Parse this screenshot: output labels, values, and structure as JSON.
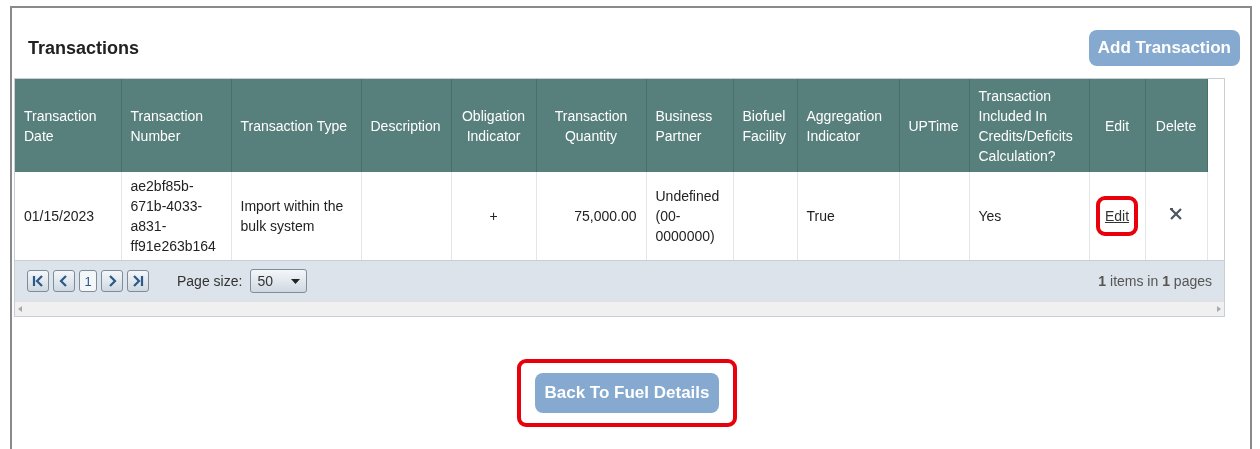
{
  "title": "Transactions",
  "add_button": {
    "label": "Add Transaction"
  },
  "table": {
    "columns": [
      "Transaction Date",
      "Transaction Number",
      "Transaction Type",
      "Description",
      "Obligation Indicator",
      "Transaction Quantity",
      "Business Partner",
      "Biofuel Facility",
      "Aggregation Indicator",
      "UPTime",
      "Transaction Included In Credits/Deficits Calculation?",
      "Edit",
      "Delete"
    ],
    "rows": [
      {
        "cells": [
          "01/15/2023",
          "ae2bf85b-671b-4033-a831-ff91e263b164",
          "Import within the bulk system",
          null,
          "+",
          "75,000.00",
          "Undefined (00-0000000)",
          null,
          "True",
          null,
          "Yes"
        ],
        "edit": {
          "label": "Edit",
          "highlighted": true
        }
      }
    ]
  },
  "pager": {
    "current_page": "1",
    "page_size_label": "Page size:",
    "page_size": "50",
    "summary": "**1** items in **1** pages"
  },
  "back_button": {
    "label": "Back To Fuel Details",
    "highlighted": true
  }
}
